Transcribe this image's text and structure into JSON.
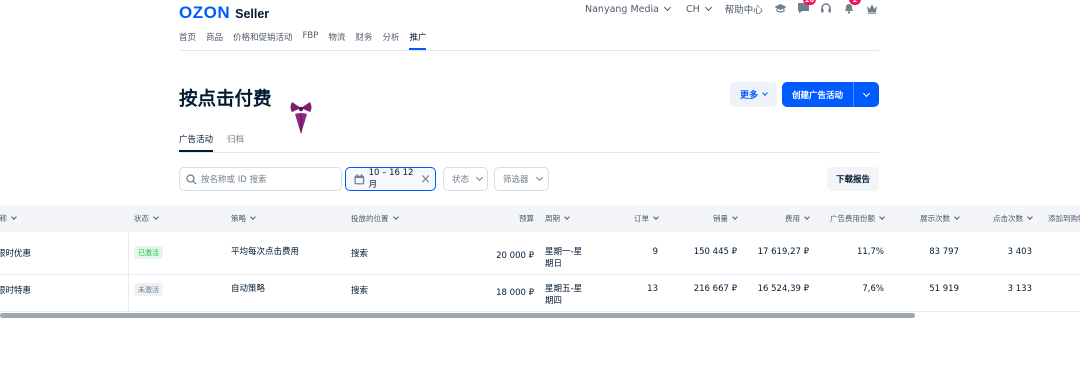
{
  "header": {
    "logo_brand": "OZON",
    "logo_product": "Seller",
    "account": "Nanyang Media",
    "currency": "CH",
    "help": "帮助中心",
    "chat_badge": "26",
    "bell_badge": "2"
  },
  "nav": {
    "items": [
      "首页",
      "商品",
      "价格和促销活动",
      "FBP",
      "物流",
      "财务",
      "分析",
      "推广"
    ],
    "active_index": 7
  },
  "page": {
    "title": "按点击付费",
    "more_label": "更多",
    "create_label": "创建广告活动"
  },
  "subtabs": [
    "广告活动",
    "归档"
  ],
  "filters": {
    "search_placeholder": "按名称或 ID 搜索",
    "date_range": "10 – 16 12月",
    "status_label": "状态",
    "filter_label": "筛选器",
    "report_label": "下载报告"
  },
  "table": {
    "headers": {
      "name": "名称",
      "status": "状态",
      "strategy": "策略",
      "placement": "投放的位置",
      "budget": "预算",
      "period": "周期",
      "orders": "订单",
      "sales": "销量",
      "cost": "费用",
      "drr": "广告费用份额",
      "impressions": "展示次数",
      "clicks": "点击次数",
      "add_to_cart": "添加到购物车"
    },
    "rows": [
      {
        "name": "限时优惠",
        "status": "已激活",
        "status_kind": "active",
        "strategy": "平均每次点击费用",
        "placement": "搜索",
        "budget": "20 000 ₽",
        "period_1": "星期一-星",
        "period_2": "期日",
        "orders": "9",
        "sales": "150 445 ₽",
        "cost": "17 619,27 ₽",
        "drr": "11,7%",
        "impressions": "83 797",
        "clicks": "3 403"
      },
      {
        "name": "限时特惠",
        "status": "未激活",
        "status_kind": "inactive",
        "strategy": "自动策略",
        "placement": "搜索",
        "budget": "18 000 ₽",
        "period_1": "星期五-星",
        "period_2": "期四",
        "orders": "13",
        "sales": "216 667 ₽",
        "cost": "16 524,39 ₽",
        "drr": "7,6%",
        "impressions": "51 919",
        "clicks": "3 133"
      }
    ]
  },
  "colors": {
    "brand": "#005bff",
    "badge": "#f91155",
    "active_green": "#10c44c"
  }
}
